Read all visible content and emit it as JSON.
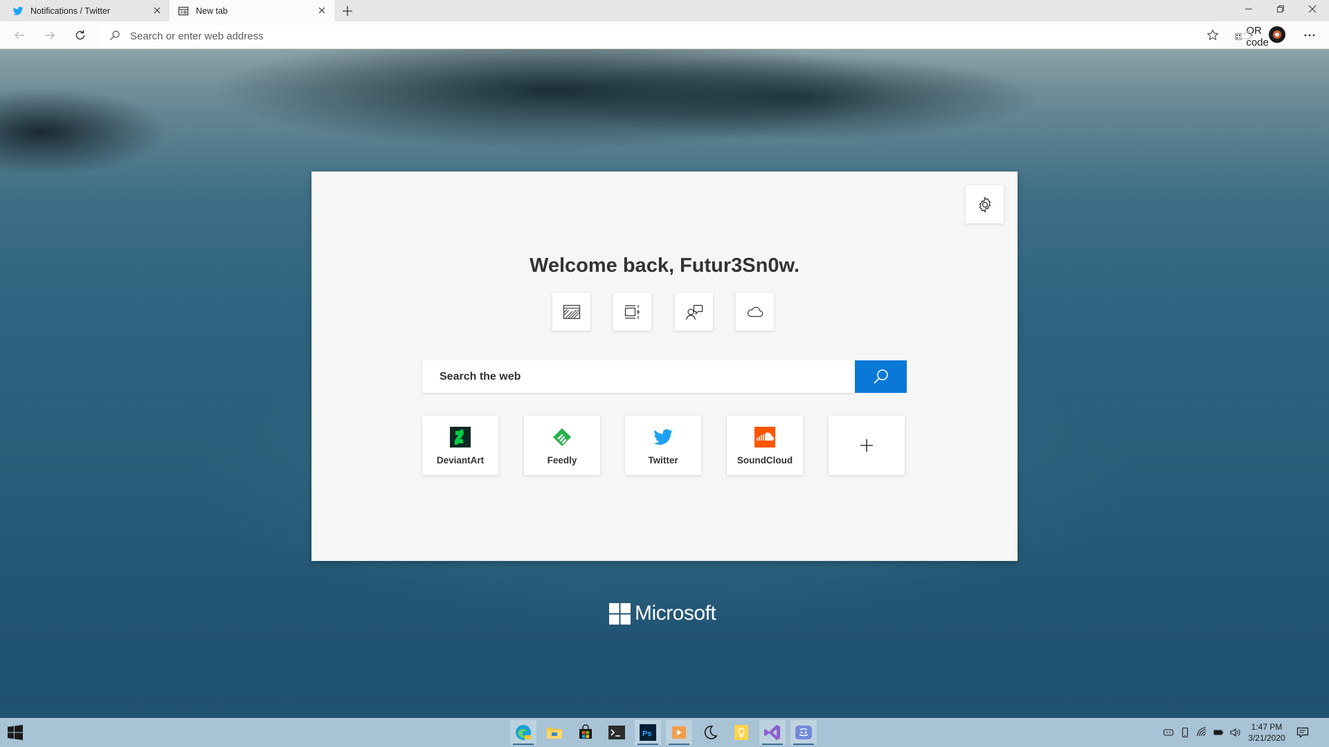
{
  "tabs": [
    {
      "title": "Notifications / Twitter",
      "icon": "twitter-icon",
      "active": false
    },
    {
      "title": "New tab",
      "icon": "newtab-icon",
      "active": true
    }
  ],
  "address_bar": {
    "placeholder": "Search or enter web address",
    "qr_label": "QR code"
  },
  "new_tab": {
    "welcome": "Welcome back, Futur3Sn0w.",
    "quick_actions": [
      "background-image-icon",
      "layout-icon",
      "feedback-icon",
      "cloud-icon"
    ],
    "search_placeholder": "Search the web",
    "tiles": [
      {
        "label": "DeviantArt",
        "icon": "deviantart-icon",
        "color": "#05cc47"
      },
      {
        "label": "Feedly",
        "icon": "feedly-icon",
        "color": "#2bb24c"
      },
      {
        "label": "Twitter",
        "icon": "twitter-icon",
        "color": "#1da1f2"
      },
      {
        "label": "SoundCloud",
        "icon": "soundcloud-icon",
        "color": "#ff5500"
      }
    ],
    "brand": "Microsoft"
  },
  "taskbar": {
    "apps": [
      "edge-canary-icon",
      "file-explorer-icon",
      "store-icon",
      "terminal-icon",
      "photoshop-icon",
      "media-player-icon",
      "moon-app-icon",
      "sticky-notes-icon",
      "visual-studio-icon",
      "discord-icon"
    ],
    "time": "1:47 PM",
    "date": "3/21/2020"
  },
  "colors": {
    "accent": "#0a78d6",
    "card_bg": "#f6f6f6",
    "taskbar_bg": "#a7c3d5"
  }
}
